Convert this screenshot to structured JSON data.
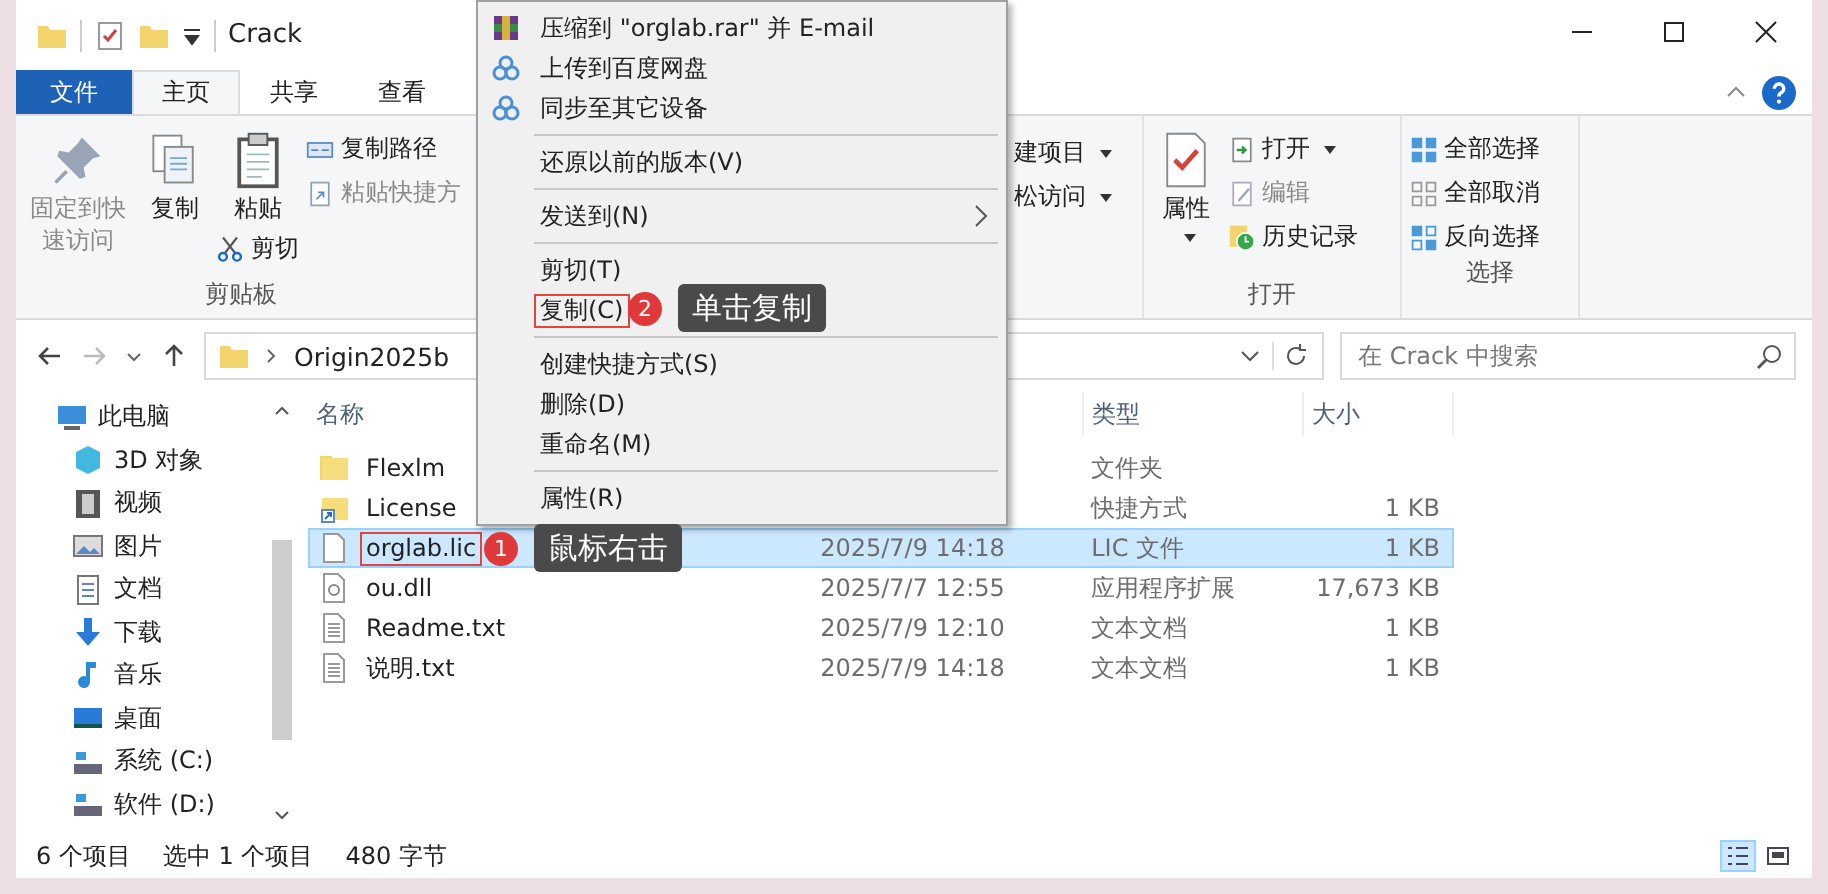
{
  "window": {
    "title": "Crack"
  },
  "ribbon_tabs": [
    {
      "label": "文件",
      "kind": "file",
      "selected": false
    },
    {
      "label": "主页",
      "kind": "tab",
      "selected": true
    },
    {
      "label": "共享",
      "kind": "tab",
      "selected": false
    },
    {
      "label": "查看",
      "kind": "tab",
      "selected": false
    }
  ],
  "ribbon": {
    "clipboard": {
      "pin": {
        "label": "固定到快速访问",
        "disabled": true
      },
      "copy": "复制",
      "paste": "粘贴",
      "copy_path": "复制路径",
      "paste_shortcut": {
        "label": "粘贴快捷方",
        "disabled": true
      },
      "cut": "剪切",
      "group_label": "剪贴板"
    },
    "new": {
      "new_item": "建项目",
      "easy_access": "松访问"
    },
    "open": {
      "properties": "属性",
      "open": "打开",
      "edit": {
        "label": "编辑",
        "disabled": true
      },
      "history": "历史记录",
      "group_label": "打开"
    },
    "select": {
      "select_all": "全部选择",
      "select_none": "全部取消",
      "invert": "反向选择",
      "group_label": "选择"
    }
  },
  "address": {
    "path": [
      "Origin2025b"
    ],
    "search_placeholder": "在 Crack 中搜索"
  },
  "nav_tree": [
    {
      "label": "此电脑",
      "children": [
        {
          "label": "3D 对象"
        },
        {
          "label": "视频"
        },
        {
          "label": "图片"
        },
        {
          "label": "文档"
        },
        {
          "label": "下载"
        },
        {
          "label": "音乐"
        },
        {
          "label": "桌面"
        },
        {
          "label": "系统 (C:)"
        },
        {
          "label": "软件 (D:)"
        }
      ]
    }
  ],
  "columns": {
    "name": "名称",
    "type": "类型",
    "size": "大小"
  },
  "files": [
    {
      "name": "Flexlm",
      "kind": "folder",
      "type": "文件夹",
      "selected": false,
      "marked": false
    },
    {
      "name": "License",
      "kind": "shortcut",
      "type": "快捷方式",
      "size": "1 KB",
      "selected": false,
      "marked": false
    },
    {
      "name": "orglab.lic",
      "kind": "file",
      "modified": "2025/7/9 14:18",
      "type": "LIC 文件",
      "size": "1 KB",
      "selected": true,
      "marked": true
    },
    {
      "name": "ou.dll",
      "kind": "dll",
      "modified": "2025/7/7 12:55",
      "type": "应用程序扩展",
      "size": "17,673 KB",
      "selected": false,
      "marked": false
    },
    {
      "name": "Readme.txt",
      "kind": "text",
      "modified": "2025/7/9 12:10",
      "type": "文本文档",
      "size": "1 KB",
      "selected": false,
      "marked": false
    },
    {
      "name": "说明.txt",
      "kind": "text",
      "modified": "2025/7/9 14:18",
      "type": "文本文档",
      "size": "1 KB",
      "selected": false,
      "marked": false
    }
  ],
  "context_menu": [
    {
      "kind": "item",
      "label": "压缩到 \"orglab.rar\" 并 E-mail",
      "submenu": false,
      "marked": false
    },
    {
      "kind": "item",
      "label": "上传到百度网盘",
      "submenu": false,
      "marked": false
    },
    {
      "kind": "item",
      "label": "同步至其它设备",
      "submenu": false,
      "marked": false
    },
    {
      "kind": "separator"
    },
    {
      "kind": "item",
      "label": "还原以前的版本(V)",
      "submenu": false,
      "marked": false
    },
    {
      "kind": "separator"
    },
    {
      "kind": "item",
      "label": "发送到(N)",
      "submenu": true,
      "marked": false
    },
    {
      "kind": "separator"
    },
    {
      "kind": "item",
      "label": "剪切(T)",
      "submenu": false,
      "marked": false
    },
    {
      "kind": "item",
      "label": "复制(C)",
      "submenu": false,
      "marked": true
    },
    {
      "kind": "separator"
    },
    {
      "kind": "item",
      "label": "创建快捷方式(S)",
      "submenu": false,
      "marked": false
    },
    {
      "kind": "item",
      "label": "删除(D)",
      "submenu": false,
      "marked": false
    },
    {
      "kind": "item",
      "label": "重命名(M)",
      "submenu": false,
      "marked": false
    },
    {
      "kind": "separator"
    },
    {
      "kind": "item",
      "label": "属性(R)",
      "submenu": false,
      "marked": false
    }
  ],
  "callouts": [
    {
      "number": "1",
      "text": "鼠标右击"
    },
    {
      "number": "2",
      "text": "单击复制"
    }
  ],
  "status_bar": {
    "count": "6 个项目",
    "selection": "选中 1 个项目",
    "size": "480 字节"
  },
  "view_buttons": [
    {
      "kind": "details",
      "selected": true
    },
    {
      "kind": "large",
      "selected": false
    }
  ]
}
